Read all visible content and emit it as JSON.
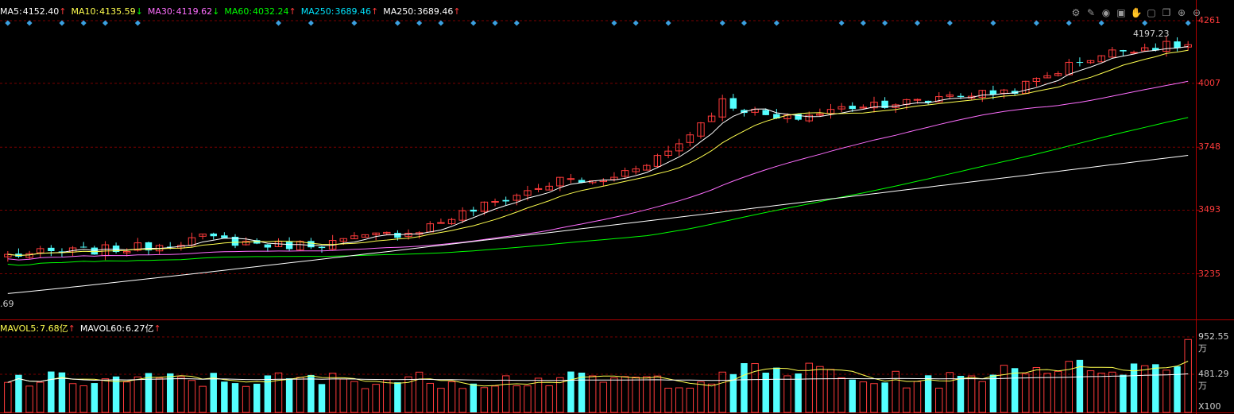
{
  "ma_legend": [
    {
      "label": "MA5:",
      "value": "4152.40",
      "arrow": "↑",
      "color": "#ffffff"
    },
    {
      "label": "MA10:",
      "value": "4135.59",
      "arrow": "↓",
      "color": "#ffff4f"
    },
    {
      "label": "MA30:",
      "value": "4119.62",
      "arrow": "↓",
      "color": "#ff6eff"
    },
    {
      "label": "MA60:",
      "value": "4032.24",
      "arrow": "↑",
      "color": "#00ff00"
    },
    {
      "label": "MA250:",
      "value": "3689.46",
      "arrow": "↑",
      "color": "#00e5ff"
    },
    {
      "label": "MA250:",
      "value": "3689.46",
      "arrow": "↑",
      "color": "#ffffff"
    }
  ],
  "vol_legend": [
    {
      "label": "MAVOL5:",
      "value": "7.68亿",
      "arrow": "↑",
      "color": "#ffff4f"
    },
    {
      "label": "MAVOL60:",
      "value": "6.27亿",
      "arrow": "↑",
      "color": "#ffffff"
    }
  ],
  "toolbar_icons": [
    "settings-icon",
    "edit-icon",
    "eye-icon",
    "box-icon",
    "hand-icon",
    "lock-icon",
    "copy-icon",
    "zoom-in-icon",
    "zoom-out-icon"
  ],
  "price_axis_ticks": [
    "4261",
    "4007",
    "3748",
    "3493",
    "3235"
  ],
  "volume_axis_ticks": [
    "952.55万",
    "481.29万"
  ],
  "volume_unit": "X100",
  "high_label": "4197.23",
  "low_label": ".69",
  "colors": {
    "up": "#ff3b3b",
    "down": "#54ffff",
    "ma5": "#ffffff",
    "ma10": "#ffff4f",
    "ma30": "#ff6eff",
    "ma60": "#00ff00",
    "ma250": "#ffffff",
    "grid": "#7a0000",
    "marker": "#3aa0e0"
  },
  "chart_data": {
    "type": "candlestick",
    "ylim": [
      3050,
      4261
    ],
    "volume_ylim": [
      0,
      952.55
    ],
    "candle_count": 110,
    "candles_seed_note": "",
    "ma_values": {
      "MA5": 4152.4,
      "MA10": 4135.59,
      "MA30": 4119.62,
      "MA60": 4032.24,
      "MA250": 3689.46
    },
    "last_price_max": 4197.23,
    "ma250_range": [
      3155,
      3715
    ],
    "vol_ticks": [
      952.55,
      481.29
    ]
  }
}
